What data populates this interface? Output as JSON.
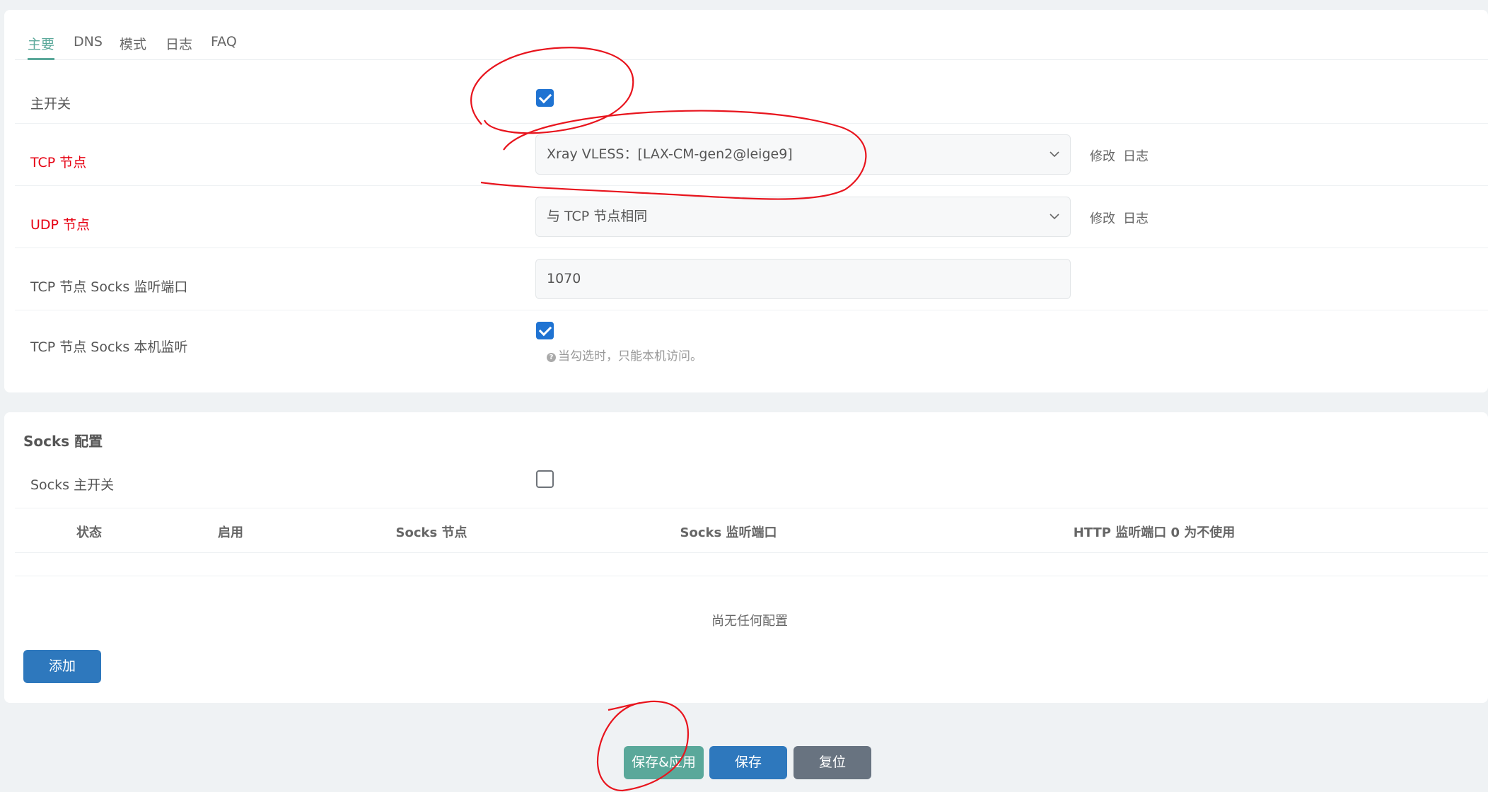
{
  "tabs": [
    {
      "label": "主要",
      "active": true
    },
    {
      "label": "DNS",
      "active": false
    },
    {
      "label": "模式",
      "active": false
    },
    {
      "label": "日志",
      "active": false
    },
    {
      "label": "FAQ",
      "active": false
    }
  ],
  "main": {
    "master_switch": {
      "label": "主开关",
      "checked": true
    },
    "tcp_node": {
      "label": "TCP 节点",
      "value": "Xray VLESS：[LAX-CM-gen2@leige9]",
      "edit": "修改",
      "log": "日志"
    },
    "udp_node": {
      "label": "UDP 节点",
      "value": "与 TCP 节点相同",
      "edit": "修改",
      "log": "日志"
    },
    "socks_port": {
      "label": "TCP 节点 Socks 监听端口",
      "value": "1070"
    },
    "socks_local": {
      "label": "TCP 节点 Socks 本机监听",
      "checked": true,
      "hint_icon": "?",
      "hint": "当勾选时，只能本机访问。"
    }
  },
  "socks": {
    "title": "Socks 配置",
    "switch": {
      "label": "Socks 主开关",
      "checked": false
    },
    "columns": [
      "状态",
      "启用",
      "Socks 节点",
      "Socks 监听端口",
      "HTTP 监听端口 0 为不使用"
    ],
    "empty": "尚无任何配置",
    "add_label": "添加"
  },
  "footer": {
    "save_apply": "保存&应用",
    "save": "保存",
    "reset": "复位"
  },
  "colors": {
    "accent": "#5aa89a",
    "primary": "#2e78bd",
    "neutral": "#687380",
    "required_label": "#e60012",
    "annotation": "#e8141d"
  }
}
